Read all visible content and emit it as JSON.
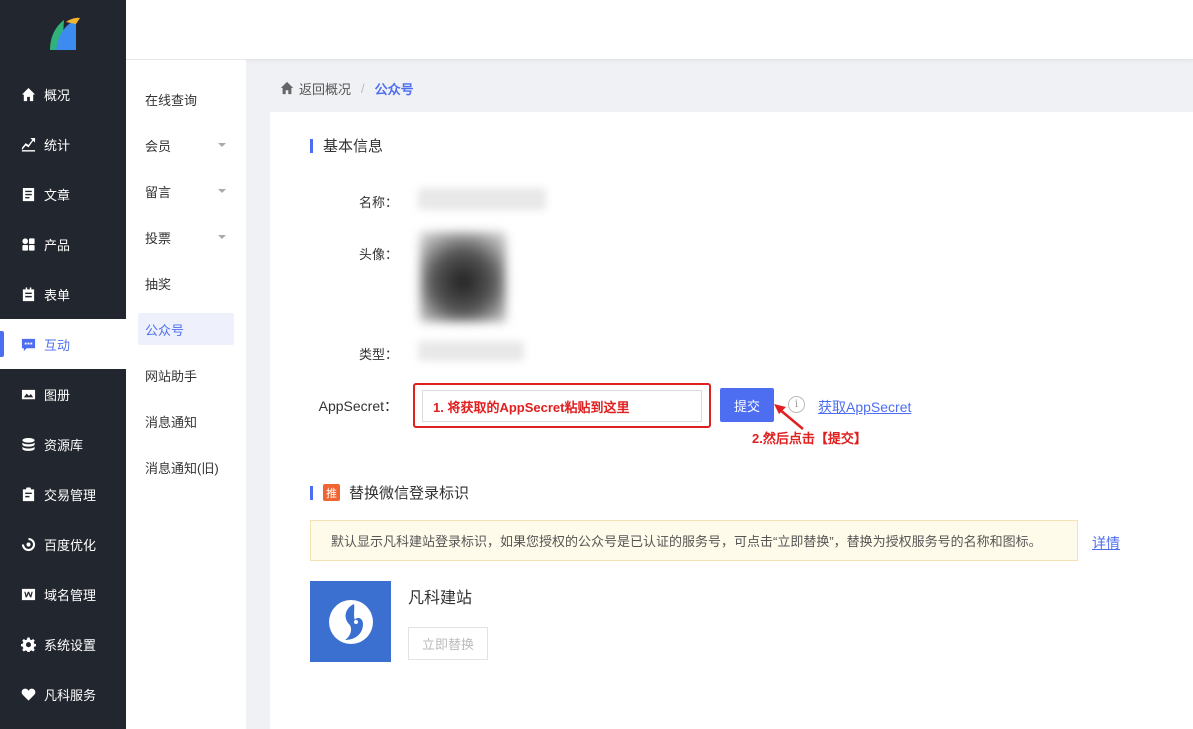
{
  "sidebar": {
    "items": [
      {
        "label": "概况",
        "icon": "home-icon"
      },
      {
        "label": "统计",
        "icon": "stats-icon"
      },
      {
        "label": "文章",
        "icon": "article-icon"
      },
      {
        "label": "产品",
        "icon": "product-icon"
      },
      {
        "label": "表单",
        "icon": "form-icon"
      },
      {
        "label": "互动",
        "icon": "chat-icon"
      },
      {
        "label": "图册",
        "icon": "album-icon"
      },
      {
        "label": "资源库",
        "icon": "database-icon"
      },
      {
        "label": "交易管理",
        "icon": "trade-icon"
      },
      {
        "label": "百度优化",
        "icon": "seo-icon"
      },
      {
        "label": "域名管理",
        "icon": "domain-icon"
      },
      {
        "label": "系统设置",
        "icon": "gear-icon"
      },
      {
        "label": "凡科服务",
        "icon": "heart-icon"
      }
    ],
    "active_index": 5
  },
  "submenu": {
    "items": [
      {
        "label": "在线查询",
        "caret": false
      },
      {
        "label": "会员",
        "caret": true
      },
      {
        "label": "留言",
        "caret": true
      },
      {
        "label": "投票",
        "caret": true
      },
      {
        "label": "抽奖",
        "caret": false
      },
      {
        "label": "公众号",
        "caret": false
      },
      {
        "label": "网站助手",
        "caret": false
      },
      {
        "label": "消息通知",
        "caret": false
      },
      {
        "label": "消息通知(旧)",
        "caret": false
      }
    ],
    "active_index": 5
  },
  "breadcrumb": {
    "back_label": "返回概况",
    "separator": "/",
    "current": "公众号"
  },
  "basic_info": {
    "title": "基本信息",
    "name_label": "名称：",
    "avatar_label": "头像：",
    "type_label": "类型：",
    "appsecret_label": "AppSecret：",
    "appsecret_value": "1. 将获取的AppSecret粘贴到这里",
    "submit_label": "提交",
    "info_glyph": "i",
    "get_link": "获取AppSecret",
    "annotation": "2.然后点击【提交】"
  },
  "replace_section": {
    "badge": "推",
    "title": "替换微信登录标识",
    "notice": "默认显示凡科建站登录标识，如果您授权的公众号是已认证的服务号，可点击“立即替换”，替换为授权服务号的名称和图标。",
    "detail_link": "详情",
    "brand_name": "凡科建站",
    "replace_button": "立即替换"
  },
  "colors": {
    "accent": "#4e6ef2",
    "sidebar_bg": "#22262e",
    "annotation_red": "#e02020",
    "brand_blue": "#3b6fd0"
  }
}
